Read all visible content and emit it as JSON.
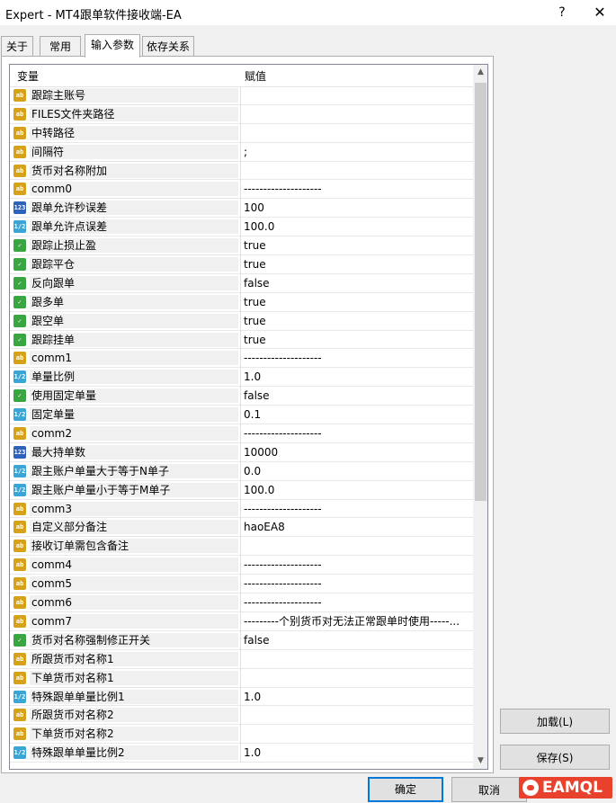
{
  "window": {
    "title": "Expert - MT4跟单软件接收端-EA",
    "help_label": "?",
    "close_label": "✕"
  },
  "tabs": [
    {
      "label": "关于"
    },
    {
      "label": "常用"
    },
    {
      "label": "输入参数"
    },
    {
      "label": "依存关系"
    }
  ],
  "active_tab": "输入参数",
  "grid": {
    "col_variable": "变量",
    "col_value": "赋值",
    "rows": [
      {
        "icon": "ab",
        "name": "跟踪主账号",
        "value": ""
      },
      {
        "icon": "ab",
        "name": "FILES文件夹路径",
        "value": ""
      },
      {
        "icon": "ab",
        "name": "中转路径",
        "value": ""
      },
      {
        "icon": "ab",
        "name": "间隔符",
        "value": ";"
      },
      {
        "icon": "ab",
        "name": "货币对名称附加",
        "value": ""
      },
      {
        "icon": "ab",
        "name": "comm0",
        "value": "--------------------"
      },
      {
        "icon": "123",
        "name": "跟单允许秒误差",
        "value": "100"
      },
      {
        "icon": "1/2",
        "name": "跟单允许点误差",
        "value": "100.0"
      },
      {
        "icon": "bool",
        "name": "跟踪止损止盈",
        "value": "true"
      },
      {
        "icon": "bool",
        "name": "跟踪平仓",
        "value": "true"
      },
      {
        "icon": "bool",
        "name": "反向跟单",
        "value": "false"
      },
      {
        "icon": "bool",
        "name": "跟多单",
        "value": "true"
      },
      {
        "icon": "bool",
        "name": "跟空单",
        "value": "true"
      },
      {
        "icon": "bool",
        "name": "跟踪挂单",
        "value": "true"
      },
      {
        "icon": "ab",
        "name": "comm1",
        "value": "--------------------"
      },
      {
        "icon": "1/2",
        "name": "单量比例",
        "value": "1.0"
      },
      {
        "icon": "bool",
        "name": "使用固定单量",
        "value": "false"
      },
      {
        "icon": "1/2",
        "name": "固定单量",
        "value": "0.1"
      },
      {
        "icon": "ab",
        "name": "comm2",
        "value": "--------------------"
      },
      {
        "icon": "123",
        "name": "最大持单数",
        "value": "10000"
      },
      {
        "icon": "1/2",
        "name": "跟主账户单量大于等于N单子",
        "value": "0.0"
      },
      {
        "icon": "1/2",
        "name": "跟主账户单量小于等于M单子",
        "value": "100.0"
      },
      {
        "icon": "ab",
        "name": "comm3",
        "value": "--------------------"
      },
      {
        "icon": "ab",
        "name": "自定义部分备注",
        "value": "haoEA8"
      },
      {
        "icon": "ab",
        "name": "接收订单需包含备注",
        "value": ""
      },
      {
        "icon": "ab",
        "name": "comm4",
        "value": "--------------------"
      },
      {
        "icon": "ab",
        "name": "comm5",
        "value": "--------------------"
      },
      {
        "icon": "ab",
        "name": "comm6",
        "value": "--------------------"
      },
      {
        "icon": "ab",
        "name": "comm7",
        "value": "---------个别货币对无法正常跟单时使用-----..."
      },
      {
        "icon": "bool",
        "name": "货币对名称强制修正开关",
        "value": "false"
      },
      {
        "icon": "ab",
        "name": "所跟货币对名称1",
        "value": ""
      },
      {
        "icon": "ab",
        "name": "下单货币对名称1",
        "value": ""
      },
      {
        "icon": "1/2",
        "name": "特殊跟单单量比例1",
        "value": "1.0"
      },
      {
        "icon": "ab",
        "name": "所跟货币对名称2",
        "value": ""
      },
      {
        "icon": "ab",
        "name": "下单货币对名称2",
        "value": ""
      },
      {
        "icon": "1/2",
        "name": "特殊跟单单量比例2",
        "value": "1.0"
      }
    ]
  },
  "buttons": {
    "load": "加载(L)",
    "save": "保存(S)",
    "ok": "确定",
    "cancel": "取消"
  },
  "scroll": {
    "up_glyph": "▲",
    "down_glyph": "▼"
  },
  "logo": {
    "text": "EAMQL"
  },
  "colors": {
    "accent": "#0078d7",
    "logo": "#e8412c"
  }
}
